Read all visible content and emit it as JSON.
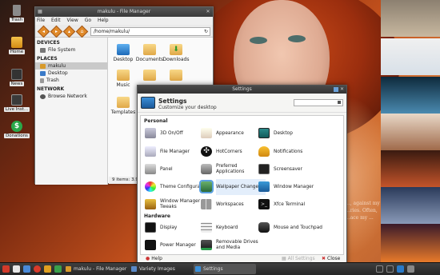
{
  "desktop_icons": [
    {
      "label": "Trash",
      "icon": "trash-icon"
    },
    {
      "label": "Home",
      "icon": "home-folder-icon"
    },
    {
      "label": "News",
      "icon": "news-icon"
    },
    {
      "label": "Live Inst...",
      "icon": "installer-icon"
    },
    {
      "label": "Donations",
      "icon": "dollar-icon"
    }
  ],
  "wallpaper_text": "..., against my ...ries. Often, ...ace my ...",
  "file_manager": {
    "title": "makulu - File Manager",
    "menu": [
      "File",
      "Edit",
      "View",
      "Go",
      "Help"
    ],
    "path": "/home/makulu/",
    "devices_heading": "DEVICES",
    "devices": [
      "File System"
    ],
    "places_heading": "PLACES",
    "places": [
      "makulu",
      "Desktop",
      "Trash"
    ],
    "network_heading": "NETWORK",
    "network": [
      "Browse Network"
    ],
    "items": [
      "Desktop",
      "Documents",
      "Downloads",
      "Music",
      "",
      "",
      "Templates"
    ],
    "status": "9 items: 3.9"
  },
  "settings": {
    "title": "Settings",
    "heading": "Settings",
    "subheading": "Customize your desktop",
    "personal_heading": "Personal",
    "personal": [
      "3D On/Off",
      "Appearance",
      "Desktop",
      "File Manager",
      "HotCorners",
      "Notifications",
      "Panel",
      "Preferred Applications",
      "Screensaver",
      "Theme Configuration",
      "Wallpaper Changer",
      "Window Manager",
      "Window Manager Tweaks",
      "Workspaces",
      "Xfce Terminal"
    ],
    "hardware_heading": "Hardware",
    "hardware": [
      "Display",
      "Keyboard",
      "Mouse and Touchpad",
      "Power Manager",
      "Removable Drives and Media"
    ],
    "help_label": "Help",
    "all_settings_label": "All Settings",
    "close_label": "Close"
  },
  "taskbar": {
    "tasks": [
      "makulu - File Manager",
      "Variety Images",
      "Settings"
    ]
  },
  "colors": {
    "accent": "#e08a2a",
    "selection": "#5aa0e0",
    "taskbar": "#2e2e2e"
  }
}
